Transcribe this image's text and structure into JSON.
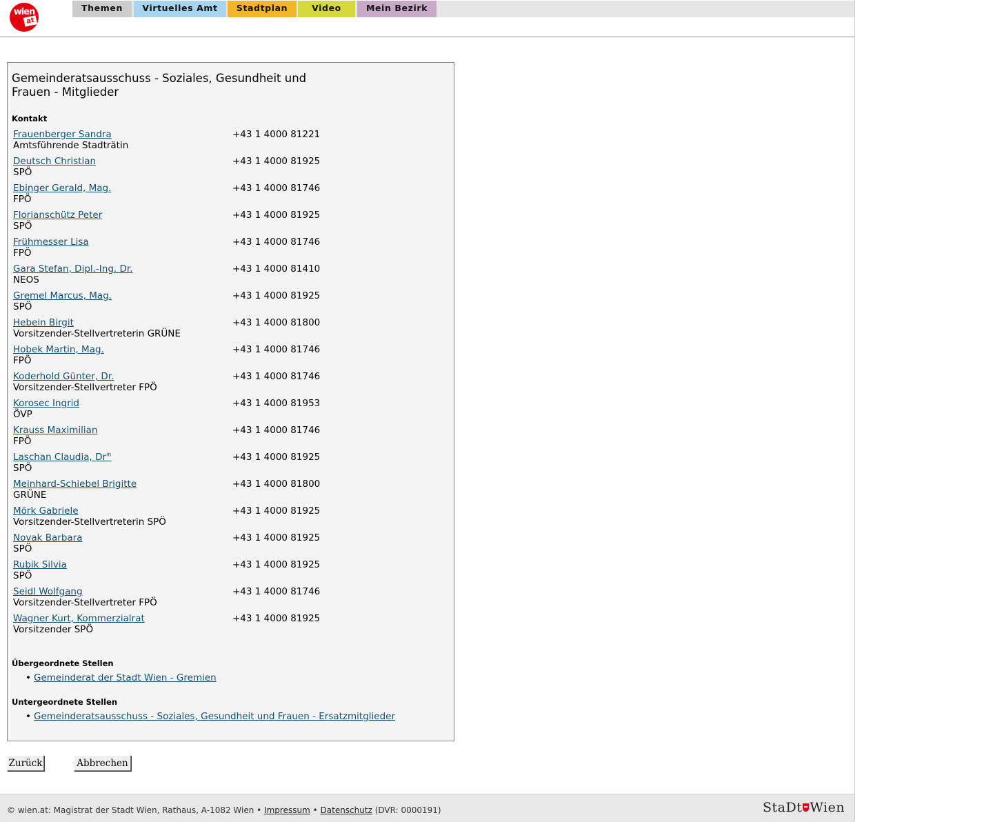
{
  "header": {
    "logo": {
      "line1": "wien",
      "line2": "at"
    },
    "nav": [
      {
        "label": "Themen",
        "color": "#cccccc"
      },
      {
        "label": "Virtuelles Amt",
        "color": "#a8d4ee"
      },
      {
        "label": "Stadtplan",
        "color": "#f2b62a"
      },
      {
        "label": "Video",
        "color": "#d6d93a"
      },
      {
        "label": "Mein Bezirk",
        "color": "#c9a9c8"
      }
    ]
  },
  "main": {
    "title": "Gemeinderatsausschuss - Soziales, Gesundheit und Frauen - Mitglieder",
    "kontakt_label": "Kontakt",
    "members": [
      {
        "name": "Frauenberger Sandra",
        "role": "Amtsführende Stadträtin",
        "phone": "+43 1 4000 81221"
      },
      {
        "name": "Deutsch Christian",
        "role": "SPÖ",
        "phone": "+43 1 4000 81925"
      },
      {
        "name": "Ebinger Gerald, Mag.",
        "role": "FPÖ",
        "phone": "+43 1 4000 81746"
      },
      {
        "name": "Florianschütz Peter",
        "role": "SPÖ",
        "phone": "+43 1 4000 81925"
      },
      {
        "name": "Frühmesser Lisa",
        "role": "FPÖ",
        "phone": "+43 1 4000 81746"
      },
      {
        "name": "Gara Stefan, Dipl.-Ing. Dr.",
        "role": "NEOS",
        "phone": "+43 1 4000 81410"
      },
      {
        "name": "Gremel Marcus, Mag.",
        "role": "SPÖ",
        "phone": "+43 1 4000 81925"
      },
      {
        "name": "Hebein Birgit",
        "role": "Vorsitzender-Stellvertreterin GRÜNE",
        "phone": "+43 1 4000 81800"
      },
      {
        "name": "Hobek Martin, Mag.",
        "role": "FPÖ",
        "phone": "+43 1 4000 81746"
      },
      {
        "name": "Koderhold Günter, Dr.",
        "role": "Vorsitzender-Stellvertreter FPÖ",
        "phone": "+43 1 4000 81746"
      },
      {
        "name": "Korosec Ingrid",
        "role": "ÖVP",
        "phone": "+43 1 4000 81953"
      },
      {
        "name": "Krauss Maximilian",
        "role": "FPÖ",
        "phone": "+43 1 4000 81746"
      },
      {
        "name": "Laschan Claudia, Dr",
        "name_sup": "in",
        "role": "SPÖ",
        "phone": "+43 1 4000 81925"
      },
      {
        "name": "Meinhard-Schiebel Brigitte",
        "role": "GRÜNE",
        "phone": "+43 1 4000 81800"
      },
      {
        "name": "Mörk Gabriele",
        "role": "Vorsitzender-Stellvertreterin SPÖ",
        "phone": "+43 1 4000 81925"
      },
      {
        "name": "Novak Barbara",
        "role": "SPÖ",
        "phone": "+43 1 4000 81925"
      },
      {
        "name": "Rubik Silvia",
        "role": "SPÖ",
        "phone": "+43 1 4000 81925"
      },
      {
        "name": "Seidl Wolfgang",
        "role": "Vorsitzender-Stellvertreter FPÖ",
        "phone": "+43 1 4000 81746"
      },
      {
        "name": "Wagner Kurt, Kommerzialrat",
        "role": "Vorsitzender SPÖ",
        "phone": "+43 1 4000 81925"
      }
    ],
    "parent": {
      "label": "Übergeordnete Stellen",
      "links": [
        "Gemeinderat der Stadt Wien - Gremien"
      ]
    },
    "child": {
      "label": "Untergeordnete Stellen",
      "links": [
        "Gemeinderatsausschuss - Soziales, Gesundheit und Frauen - Ersatzmitglieder"
      ]
    }
  },
  "buttons": {
    "back": "Zurück",
    "cancel": "Abbrechen"
  },
  "footer": {
    "prefix": "© wien.at: Magistrat der Stadt Wien, Rathaus, A-1082 Wien •",
    "impressum": "Impressum",
    "sep": "•",
    "datenschutz": "Datenschutz",
    "dvr": "(DVR: 0000191)",
    "brand_left": "StaDt",
    "brand_right": "Wien"
  }
}
